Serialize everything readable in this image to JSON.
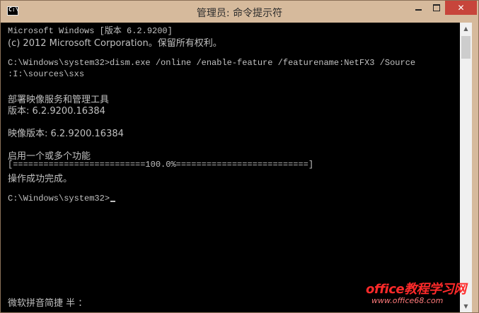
{
  "window": {
    "title": "管理员: 命令提示符",
    "icon_text": "C:\\",
    "icon": "cmd-icon",
    "controls": {
      "minimize": "minimize-icon",
      "maximize": "maximize-icon",
      "close": "✕"
    }
  },
  "console": {
    "lines": [
      "Microsoft Windows [版本 6.2.9200]",
      "(c) 2012 Microsoft Corporation。保留所有权利。",
      "",
      "C:\\Windows\\system32>dism.exe /online /enable-feature /featurename:NetFX3 /Source",
      ":I:\\sources\\sxs",
      "",
      "部署映像服务和管理工具",
      "版本: 6.2.9200.16384",
      "",
      "映像版本: 6.2.9200.16384",
      "",
      "启用一个或多个功能",
      "[==========================100.0%==========================]",
      "操作成功完成。",
      "",
      "C:\\Windows\\system32>"
    ],
    "ime_status": "微软拼音简捷 半 ：",
    "progress_percent": 100.0
  },
  "colors": {
    "titlebar": "#d6ba9c",
    "console_bg": "#000000",
    "console_text": "#c0c0c0",
    "close_button": "#c7453b"
  },
  "watermark": {
    "title": "office教程学习网",
    "url": "www.office68.com"
  }
}
